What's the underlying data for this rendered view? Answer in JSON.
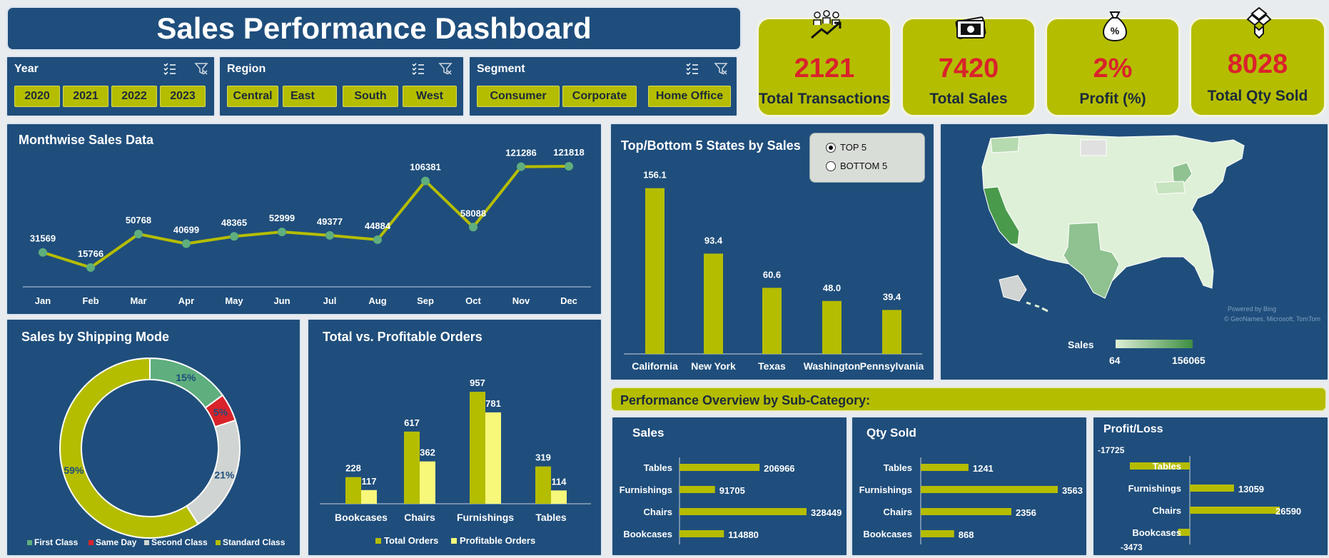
{
  "title": "Sales Performance Dashboard",
  "slicers": {
    "year": {
      "label": "Year",
      "items": [
        "2020",
        "2021",
        "2022",
        "2023"
      ]
    },
    "region": {
      "label": "Region",
      "items": [
        "Central",
        "East",
        "South",
        "West"
      ]
    },
    "segment": {
      "label": "Segment",
      "items": [
        "Consumer",
        "Corporate",
        "Home Office"
      ]
    }
  },
  "kpis": [
    {
      "value": "2121",
      "label": "Total Transactions",
      "icon": "people-growth-icon"
    },
    {
      "value": "7420",
      "label": "Total Sales",
      "icon": "cash-icon"
    },
    {
      "value": "2%",
      "label": "Profit (%)",
      "icon": "money-bag-icon"
    },
    {
      "value": "8028",
      "label": "Total Qty Sold",
      "icon": "boxes-icon"
    }
  ],
  "monthwise": {
    "title": "Monthwise Sales Data"
  },
  "shipping": {
    "title": "Sales by Shipping  Mode"
  },
  "orders": {
    "title": "Total vs. Profitable Orders"
  },
  "states": {
    "title": "Top/Bottom 5 States by Sales",
    "options": [
      "TOP 5",
      "BOTTOM 5"
    ],
    "selected": "TOP 5"
  },
  "map": {
    "legend_title": "Sales",
    "min": "64",
    "max": "156065",
    "credit1": "Powered by Bing",
    "credit2": "© GeoNames, Microsoft, TomTom"
  },
  "subcategory": {
    "band": "Performance Overview by Sub-Category:",
    "sales_title": "Sales",
    "qty_title": "Qty Sold",
    "pl_title": "Profit/Loss"
  },
  "colors": {
    "panel": "#1f4e7c",
    "accent": "#b5bd00",
    "kpi_value": "#d9232b",
    "profitable": "#f7f77a"
  },
  "chart_data": [
    {
      "type": "line",
      "title": "Monthwise Sales Data",
      "categories": [
        "Jan",
        "Feb",
        "Mar",
        "Apr",
        "May",
        "Jun",
        "Jul",
        "Aug",
        "Sep",
        "Oct",
        "Nov",
        "Dec"
      ],
      "values": [
        31569,
        15766,
        50768,
        40699,
        48365,
        52999,
        49377,
        44884,
        106381,
        58088,
        121286,
        121818
      ],
      "labels": [
        "31569",
        "15766",
        "50768",
        "40699",
        "48365",
        "52999",
        "49377",
        "44884",
        "106381",
        "58088",
        "121286",
        "121818"
      ]
    },
    {
      "type": "pie",
      "title": "Sales by Shipping  Mode",
      "categories": [
        "First Class",
        "Same Day",
        "Second Class",
        "Standard Class"
      ],
      "values": [
        15,
        5,
        21,
        59
      ],
      "labels": [
        "15%",
        "5%",
        "21%",
        "59%"
      ],
      "colors": [
        "#5fae7e",
        "#d9232b",
        "#d0d4d2",
        "#b5bd00"
      ],
      "legend": "bottom"
    },
    {
      "type": "bar",
      "title": "Total vs. Profitable Orders",
      "categories": [
        "Bookcases",
        "Chairs",
        "Furnishings",
        "Tables"
      ],
      "series": [
        {
          "name": "Total Orders",
          "values": [
            228,
            617,
            957,
            319
          ],
          "labels": [
            "228",
            "617",
            "957",
            "319"
          ]
        },
        {
          "name": "Profitable Orders",
          "values": [
            117,
            362,
            781,
            114
          ],
          "labels": [
            "117",
            "362",
            "781",
            "114"
          ]
        }
      ],
      "legend": "bottom"
    },
    {
      "type": "bar",
      "title": "Top/Bottom 5 States by Sales",
      "categories": [
        "California",
        "New York",
        "Texas",
        "Washington",
        "Pennsylvania"
      ],
      "values": [
        156.1,
        93.4,
        60.6,
        48.0,
        39.4
      ],
      "labels": [
        "156.1",
        "93.4",
        "60.6",
        "48.0",
        "39.4"
      ]
    },
    {
      "type": "bar",
      "title": "Sales",
      "categories": [
        "Tables",
        "Furnishings",
        "Chairs",
        "Bookcases"
      ],
      "values": [
        206966,
        91705,
        328449,
        114880
      ],
      "labels": [
        "206966",
        "91705",
        "328449",
        "114880"
      ]
    },
    {
      "type": "bar",
      "title": "Qty Sold",
      "categories": [
        "Tables",
        "Furnishings",
        "Chairs",
        "Bookcases"
      ],
      "values": [
        1241,
        3563,
        2356,
        868
      ],
      "labels": [
        "1241",
        "3563",
        "2356",
        "868"
      ]
    },
    {
      "type": "bar",
      "title": "Profit/Loss",
      "categories": [
        "Tables",
        "Furnishings",
        "Chairs",
        "Bookcases"
      ],
      "values": [
        -17725,
        13059,
        26590,
        -3473
      ],
      "labels": [
        "-17725",
        "13059",
        "26590",
        "-3473"
      ]
    }
  ]
}
